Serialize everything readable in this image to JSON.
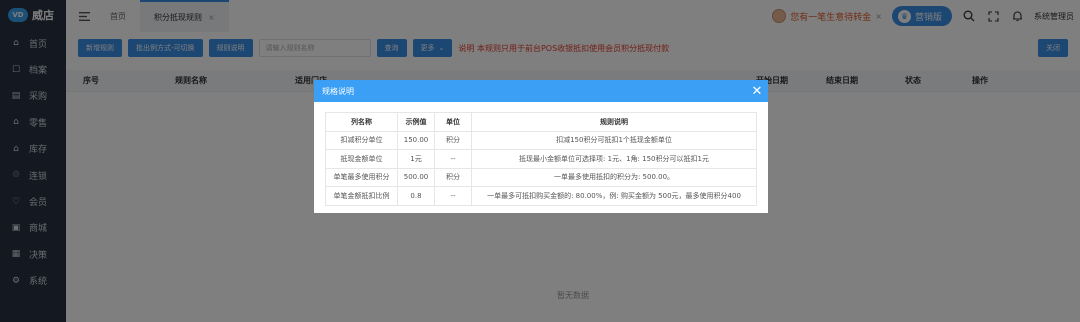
{
  "app": {
    "name": "威店",
    "logo_text": "VD"
  },
  "sidebar": {
    "items": [
      {
        "label": "首页",
        "icon": "home-icon",
        "glyph": "⌂"
      },
      {
        "label": "档案",
        "icon": "archive-icon",
        "glyph": "☐"
      },
      {
        "label": "采购",
        "icon": "purchase-icon",
        "glyph": "▤"
      },
      {
        "label": "零售",
        "icon": "retail-icon",
        "glyph": "⌂"
      },
      {
        "label": "库存",
        "icon": "inventory-icon",
        "glyph": "⌂"
      },
      {
        "label": "连锁",
        "icon": "chain-icon",
        "glyph": "♲"
      },
      {
        "label": "会员",
        "icon": "member-icon",
        "glyph": "♡"
      },
      {
        "label": "商城",
        "icon": "mall-icon",
        "glyph": "▣"
      },
      {
        "label": "决策",
        "icon": "decision-icon",
        "glyph": "▦"
      },
      {
        "label": "系统",
        "icon": "system-icon",
        "glyph": "⚙"
      }
    ]
  },
  "tabs": [
    {
      "label": "首页"
    },
    {
      "label": "积分抵现规则",
      "close": "×"
    }
  ],
  "topbar": {
    "notice": "您有一笔生意待转金",
    "notice_close": "×",
    "marketing": "营销版",
    "user": "系统管理员"
  },
  "toolbar": {
    "add": "新增规则",
    "batch": "批出例方式-可切换",
    "rule_desc": "规则说明",
    "search_placeholder": "请输入规则名称",
    "query": "查询",
    "more": "更多",
    "more_chevron": "⌄",
    "warning": "说明 本规则只用于前台POS收银抵扣使用会员积分抵现付款",
    "close": "关闭"
  },
  "table": {
    "headers": [
      "序号",
      "规则名称",
      "适用门店",
      "",
      "",
      "",
      "",
      "",
      "",
      "",
      "开始日期",
      "结束日期",
      "状态",
      "操作"
    ],
    "empty": "暂无数据"
  },
  "dialog": {
    "title": "规格说明",
    "close": "✕",
    "headers": [
      "列名称",
      "示例值",
      "单位",
      "规则说明"
    ],
    "rows": [
      {
        "name": "扣减积分单位",
        "value": "150.00",
        "unit": "积分",
        "desc": "扣减150积分可抵扣1个抵现金额单位"
      },
      {
        "name": "抵现金额单位",
        "value": "1元",
        "unit": "--",
        "desc": "抵现最小金额单位可选择项: 1元、1角: 150积分可以抵扣1元"
      },
      {
        "name": "单笔最多使用积分",
        "value": "500.00",
        "unit": "积分",
        "desc": "一单最多使用抵扣的积分为: 500.00。"
      },
      {
        "name": "单笔金额抵扣比例",
        "value": "0.8",
        "unit": "--",
        "desc": "一单最多可抵扣购买金额的: 80.00%，例: 购买金额为 500元，最多使用积分400"
      }
    ]
  }
}
